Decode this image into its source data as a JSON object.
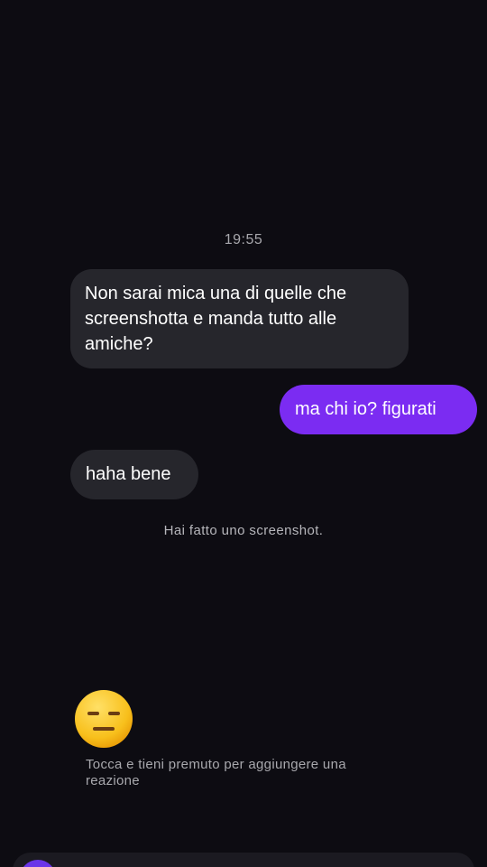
{
  "chat": {
    "timestamp": "19:55",
    "messages": [
      {
        "direction": "received",
        "text": "Non sarai mica una di quelle che screenshotta e manda tutto alle amiche?"
      },
      {
        "direction": "sent",
        "text": "ma chi io? figurati"
      },
      {
        "direction": "received",
        "text": "haha bene"
      }
    ],
    "system_note": "Hai fatto uno screenshot."
  },
  "reaction_prompt": {
    "emoji": "expressionless-face-icon",
    "hint": "Tocca e tieni premuto per aggiungere una reazione"
  },
  "colors": {
    "background": "#0d0c12",
    "received_bubble": "#26262c",
    "sent_bubble": "#7b2cf2",
    "secondary_text": "#a8a8ad"
  }
}
